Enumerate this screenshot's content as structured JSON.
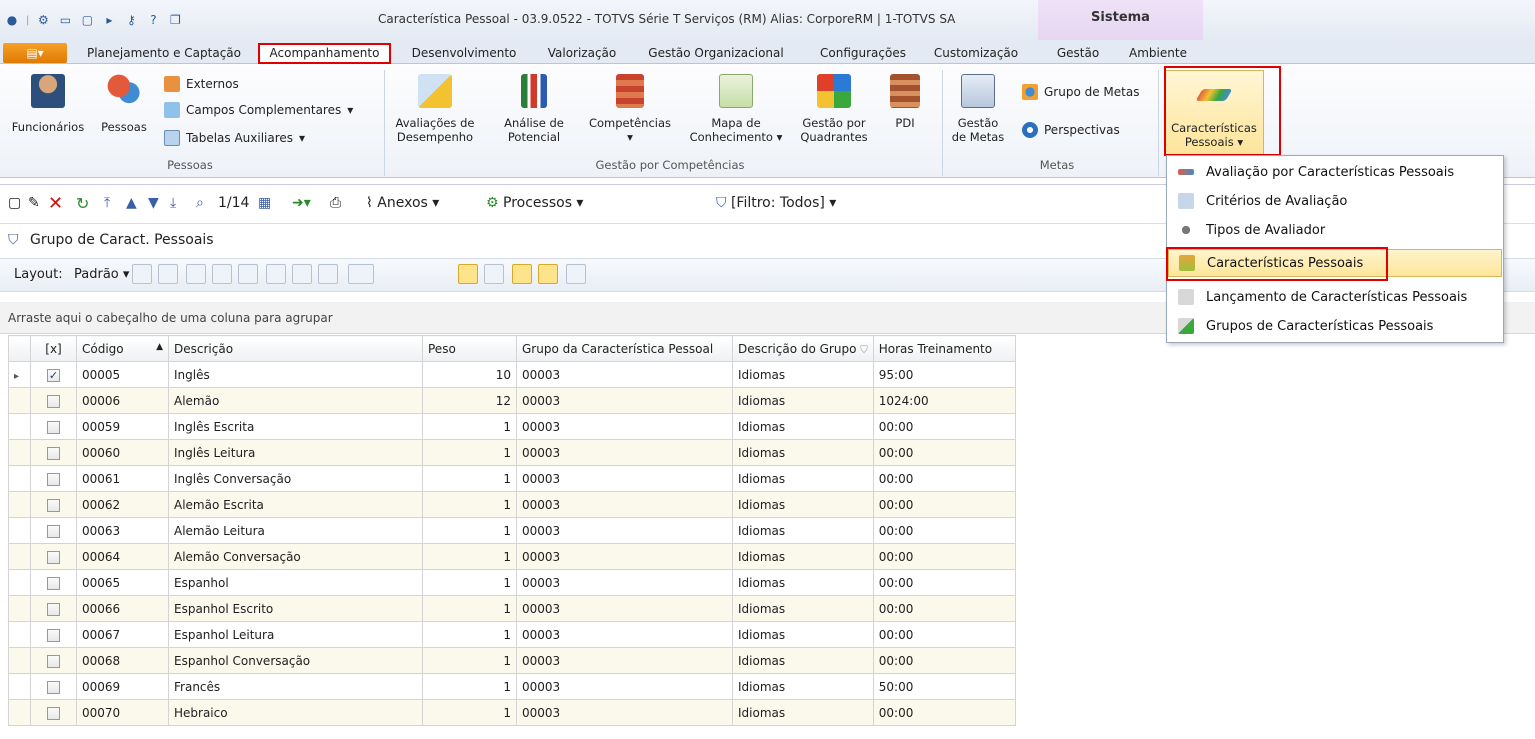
{
  "window": {
    "title": "Característica Pessoal - 03.9.0522 - TOTVS Série T Serviços (RM) Alias: CorporeRM | 1-TOTVS SA",
    "context_group": "Sistema"
  },
  "tabs": [
    "Planejamento e Captação",
    "Acompanhamento",
    "Desenvolvimento",
    "Valorização",
    "Gestão Organizacional",
    "Configurações",
    "Customização",
    "Gestão",
    "Ambiente"
  ],
  "ribbon": {
    "pessoas": {
      "funcionarios": "Funcionários",
      "pessoas": "Pessoas",
      "externos": "Externos",
      "campos": "Campos Complementares",
      "tabelas": "Tabelas Auxiliares",
      "label": "Pessoas"
    },
    "competencias": {
      "avaliacoes1": "Avaliações de",
      "avaliacoes2": "Desempenho",
      "analise1": "Análise de",
      "analise2": "Potencial",
      "comp": "Competências",
      "mapa1": "Mapa de",
      "mapa2": "Conhecimento",
      "gq1": "Gestão por",
      "gq2": "Quadrantes",
      "pdi": "PDI",
      "label": "Gestão por Competências"
    },
    "metas": {
      "gm1": "Gestão",
      "gm2": "de Metas",
      "grupo": "Grupo de Metas",
      "persp": "Perspectivas",
      "label": "Metas"
    },
    "carac": {
      "l1": "Características",
      "l2": "Pessoais"
    }
  },
  "toolbar": {
    "counter": "1/14",
    "anexos": "Anexos",
    "processos": "Processos",
    "filtro": "[Filtro: Todos]"
  },
  "panel": {
    "title": "Grupo de Caract. Pessoais",
    "layout_label": "Layout:",
    "layout_value": "Padrão"
  },
  "grid": {
    "group_hint": "Arraste aqui o cabeçalho de uma coluna para agrupar",
    "headers": {
      "sel": "[x]",
      "codigo": "Código",
      "descricao": "Descrição",
      "peso": "Peso",
      "grupo": "Grupo da Característica Pessoal",
      "descgrupo": "Descrição do Grupo",
      "horas": "Horas Treinamento"
    },
    "rows": [
      {
        "codigo": "00005",
        "descricao": "Inglês",
        "peso": "10",
        "grupo": "00003",
        "descgrupo": "Idiomas",
        "horas": "95:00",
        "checked": true
      },
      {
        "codigo": "00006",
        "descricao": "Alemão",
        "peso": "12",
        "grupo": "00003",
        "descgrupo": "Idiomas",
        "horas": "1024:00"
      },
      {
        "codigo": "00059",
        "descricao": "Inglês Escrita",
        "peso": "1",
        "grupo": "00003",
        "descgrupo": "Idiomas",
        "horas": "00:00"
      },
      {
        "codigo": "00060",
        "descricao": "Inglês Leitura",
        "peso": "1",
        "grupo": "00003",
        "descgrupo": "Idiomas",
        "horas": "00:00"
      },
      {
        "codigo": "00061",
        "descricao": "Inglês Conversação",
        "peso": "1",
        "grupo": "00003",
        "descgrupo": "Idiomas",
        "horas": "00:00"
      },
      {
        "codigo": "00062",
        "descricao": "Alemão Escrita",
        "peso": "1",
        "grupo": "00003",
        "descgrupo": "Idiomas",
        "horas": "00:00"
      },
      {
        "codigo": "00063",
        "descricao": "Alemão Leitura",
        "peso": "1",
        "grupo": "00003",
        "descgrupo": "Idiomas",
        "horas": "00:00"
      },
      {
        "codigo": "00064",
        "descricao": "Alemão Conversação",
        "peso": "1",
        "grupo": "00003",
        "descgrupo": "Idiomas",
        "horas": "00:00"
      },
      {
        "codigo": "00065",
        "descricao": "Espanhol",
        "peso": "1",
        "grupo": "00003",
        "descgrupo": "Idiomas",
        "horas": "00:00"
      },
      {
        "codigo": "00066",
        "descricao": "Espanhol Escrito",
        "peso": "1",
        "grupo": "00003",
        "descgrupo": "Idiomas",
        "horas": "00:00"
      },
      {
        "codigo": "00067",
        "descricao": "Espanhol Leitura",
        "peso": "1",
        "grupo": "00003",
        "descgrupo": "Idiomas",
        "horas": "00:00"
      },
      {
        "codigo": "00068",
        "descricao": "Espanhol Conversação",
        "peso": "1",
        "grupo": "00003",
        "descgrupo": "Idiomas",
        "horas": "00:00"
      },
      {
        "codigo": "00069",
        "descricao": "Francês",
        "peso": "1",
        "grupo": "00003",
        "descgrupo": "Idiomas",
        "horas": "50:00"
      },
      {
        "codigo": "00070",
        "descricao": "Hebraico",
        "peso": "1",
        "grupo": "00003",
        "descgrupo": "Idiomas",
        "horas": "00:00"
      }
    ]
  },
  "menu": [
    "Avaliação por Características Pessoais",
    "Critérios de Avaliação",
    "Tipos de Avaliador",
    "Características Pessoais",
    "Lançamento de Características Pessoais",
    "Grupos de Características Pessoais"
  ]
}
